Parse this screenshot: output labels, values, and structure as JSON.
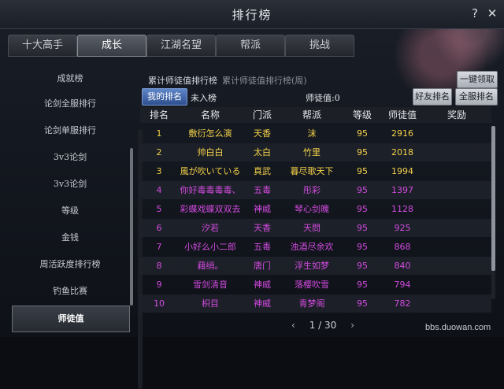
{
  "window": {
    "title": "排行榜"
  },
  "tabs": [
    {
      "label": "十大高手"
    },
    {
      "label": "成长"
    },
    {
      "label": "江湖名望"
    },
    {
      "label": "帮派"
    },
    {
      "label": "挑战"
    }
  ],
  "sidebar": {
    "items": [
      {
        "label": "成就榜"
      },
      {
        "label": "论剑全服排行"
      },
      {
        "label": "论剑单服排行"
      },
      {
        "label": "3v3论剑"
      },
      {
        "label": "3v3论剑"
      },
      {
        "label": "等级"
      },
      {
        "label": "金钱"
      },
      {
        "label": "周活跃度排行榜"
      },
      {
        "label": "钓鱼比赛"
      },
      {
        "label": "师徒值"
      }
    ]
  },
  "subtabs": {
    "active": "累计师徒值排行榜",
    "other": "累计师徒值排行榜(周)"
  },
  "buttons": {
    "claim": "一键领取",
    "my_rank": "我的排名",
    "friend_rank": "好友排名",
    "server_rank": "全服排名"
  },
  "my_rank": {
    "status": "未入榜",
    "value_text": "师徒值:0"
  },
  "table": {
    "headers": [
      "排名",
      "名称",
      "门派",
      "帮派",
      "等级",
      "师徒值",
      "奖励"
    ],
    "rows": [
      {
        "rank": "1",
        "name": "敷衍怎么演",
        "sect": "天香",
        "guild": "沫",
        "level": "95",
        "value": "2916",
        "color": "#f4d24a"
      },
      {
        "rank": "2",
        "name": "帅白白",
        "sect": "太白",
        "guild": "竹里",
        "level": "95",
        "value": "2018",
        "color": "#f4d24a"
      },
      {
        "rank": "3",
        "name": "風が吹いている",
        "sect": "真武",
        "guild": "暮尽歌天下",
        "level": "95",
        "value": "1994",
        "color": "#f4d24a"
      },
      {
        "rank": "4",
        "name": "你好毒毒毒毒、",
        "sect": "五毒",
        "guild": "彤彩",
        "level": "95",
        "value": "1397",
        "color": "#d24be0"
      },
      {
        "rank": "5",
        "name": "彩蝶戏蝶双双去",
        "sect": "神威",
        "guild": "琴心剑魄",
        "level": "95",
        "value": "1128",
        "color": "#d24be0"
      },
      {
        "rank": "6",
        "name": "汐若",
        "sect": "天香",
        "guild": "天問",
        "level": "95",
        "value": "925",
        "color": "#d24be0"
      },
      {
        "rank": "7",
        "name": "小好么小二郎",
        "sect": "五毒",
        "guild": "浊酒尽余欢",
        "level": "95",
        "value": "868",
        "color": "#d24be0"
      },
      {
        "rank": "8",
        "name": "藉绡。",
        "sect": "唐门",
        "guild": "浮生如梦",
        "level": "95",
        "value": "840",
        "color": "#d24be0"
      },
      {
        "rank": "9",
        "name": "雪剑清音",
        "sect": "神威",
        "guild": "落樱吹雪",
        "level": "95",
        "value": "794",
        "color": "#d24be0"
      },
      {
        "rank": "10",
        "name": "枳目",
        "sect": "神威",
        "guild": "青梦阁",
        "level": "95",
        "value": "782",
        "color": "#d24be0"
      }
    ]
  },
  "pager": {
    "text": "1 / 30"
  },
  "watermark": "bbs.duowan.com"
}
